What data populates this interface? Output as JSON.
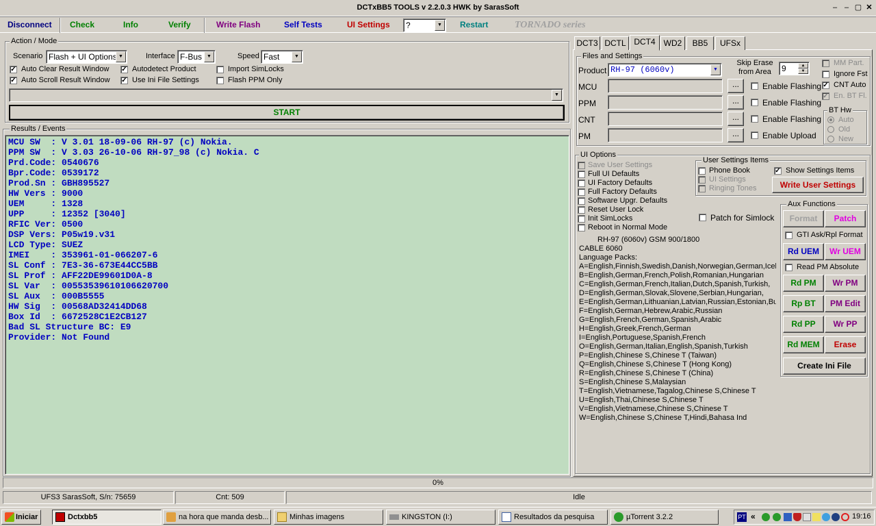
{
  "window": {
    "title": "DCTxBB5 TOOLS v 2.2.0.3 HWK by SarasSoft"
  },
  "toolbar": {
    "disconnect": "Disconnect",
    "check": "Check",
    "info": "Info",
    "verify": "Verify",
    "write_flash": "Write Flash",
    "self_tests": "Self Tests",
    "ui_settings": "UI Settings",
    "combo_value": "?",
    "restart": "Restart",
    "brand": "TORNADO series"
  },
  "action_mode": {
    "title": "Action / Mode",
    "scenario_label": "Scenario",
    "scenario_value": "Flash + UI Options",
    "interface_label": "Interface",
    "interface_value": "F-Bus",
    "speed_label": "Speed",
    "speed_value": "Fast",
    "checks": [
      {
        "label": "Auto Clear Result Window",
        "checked": true
      },
      {
        "label": "Autodetect Product",
        "checked": true
      },
      {
        "label": "Import SimLocks",
        "checked": false
      },
      {
        "label": "Auto Scroll Result Window",
        "checked": true
      },
      {
        "label": "Use Ini File Settings",
        "checked": true
      },
      {
        "label": "Flash PPM Only",
        "checked": false
      }
    ],
    "start": "START"
  },
  "results": {
    "title": "Results / Events",
    "lines": [
      "MCU SW  : V 3.01 18-09-06 RH-97 (c) Nokia.",
      "PPM SW  : V 3.03 26-10-06 RH-97_98 (c) Nokia. C",
      "Prd.Code: 0540676",
      "Bpr.Code: 0539172",
      "Prod.Sn : GBH895527",
      "HW Vers : 9000",
      "UEM     : 1328",
      "UPP     : 12352 [3040]",
      "RFIC Ver: 0500",
      "DSP Vers: P05w19.v31",
      "LCD Type: SUEZ",
      "IMEI    : 353961-01-066207-6",
      "SL Conf : 7E3-36-673E44CC5BB",
      "SL Prof : AFF22DE99601D0A-8",
      "SL Var  : 0055353961010662070­0",
      "SL Aux  : 000B5555",
      "HW Sig  : 00568AD32414DD68",
      "Box Id  : 6672528C1E2CB127",
      "Bad SL Structure BC: E9",
      "Provider: Not Found"
    ]
  },
  "tabs": [
    "DCT3",
    "DCTL",
    "DCT4",
    "WD2",
    "BB5",
    "UFSx"
  ],
  "files": {
    "title": "Files and Settings",
    "product_label": "Product",
    "product_value": "RH-97  (6060v)",
    "skip_label": "Skip Erase from Area",
    "skip_value": "9",
    "rows": [
      {
        "label": "MCU",
        "check": "Enable Flashing"
      },
      {
        "label": "PPM",
        "check": "Enable Flashing"
      },
      {
        "label": "CNT",
        "check": "Enable Flashing"
      },
      {
        "label": "PM",
        "check": "Enable Upload"
      }
    ],
    "browse": "...",
    "right_checks": [
      {
        "label": "MM Part.",
        "checked": false,
        "disabled": true
      },
      {
        "label": "Ignore Fst",
        "checked": false,
        "disabled": false
      },
      {
        "label": "CNT Auto",
        "checked": true,
        "disabled": false
      },
      {
        "label": "En. BT Fl.",
        "checked": true,
        "disabled": true
      }
    ],
    "bt_hw": {
      "title": "BT Hw",
      "options": [
        "Auto",
        "Old",
        "New"
      ]
    }
  },
  "ui_options": {
    "title": "UI Options",
    "checks": [
      {
        "label": "Save User Settings",
        "disabled": true
      },
      {
        "label": "Full UI Defaults",
        "disabled": false
      },
      {
        "label": "UI Factory Defaults",
        "disabled": false
      },
      {
        "label": "Full Factory Defaults",
        "disabled": false
      },
      {
        "label": "Software Upgr. Defaults",
        "disabled": false
      },
      {
        "label": "Reset User Lock",
        "disabled": false
      },
      {
        "label": "Init SimLocks",
        "disabled": false
      },
      {
        "label": "Reboot in Normal Mode",
        "disabled": false
      }
    ],
    "patch_simlock": "Patch for Simlock",
    "user_settings": {
      "title": "User Settings Items",
      "items": [
        {
          "label": "Phone Book",
          "disabled": false
        },
        {
          "label": "UI Settings",
          "disabled": true
        },
        {
          "label": "Ringing Tones",
          "disabled": true
        }
      ],
      "show": "Show Settings Items",
      "write": "Write User Settings"
    }
  },
  "info_text": {
    "header": "RH-97 (6060v) GSM 900/1800",
    "cable": "CABLE 6060",
    "packs_title": "Language Packs:",
    "packs": [
      "A=English,Finnish,Swedish,Danish,Norwegian,German,Icelar",
      "B=English,German,French,Polish,Romanian,Hungarian",
      "C=English,German,French,Italian,Dutch,Spanish,Turkish,",
      "D=English,German,Slovak,Slovene,Serbian,Hungarian,",
      "E=English,German,Lithuanian,Latvian,Russian,Estonian,Bulg",
      "F=English,German,Hebrew,Arabic,Russian",
      "G=English,French,German,Spanish,Arabic",
      "H=English,Greek,French,German",
      "I=English,Portuguese,Spanish,French",
      "O=English,German,Italian,English,Spanish,Turkish",
      "P=English,Chinese S,Chinese T (Taiwan)",
      "Q=English,Chinese S,Chinese T (Hong Kong)",
      "R=English,Chinese S,Chinese T (China)",
      "S=English,Chinese S,Malaysian",
      "T=English,Vietnamese,Tagalog,Chinese S,Chinese T",
      "U=English,Thai,Chinese S,Chinese T",
      "V=English,Vietnamese,Chinese S,Chinese T",
      "W=English,Chinese S,Chinese T,Hindi,Bahasa Ind"
    ]
  },
  "aux": {
    "title": "Aux Functions",
    "format": "Format",
    "patch": "Patch",
    "gti": "GTI Ask/Rpl Format",
    "rd_uem": "Rd UEM",
    "wr_uem": "Wr UEM",
    "read_pm_abs": "Read PM Absolute",
    "rd_pm": "Rd PM",
    "wr_pm": "Wr PM",
    "rp_bt": "Rp BT",
    "pm_edit": "PM Edit",
    "rd_pp": "Rd PP",
    "wr_pp": "Wr PP",
    "rd_mem": "Rd MEM",
    "erase": "Erase",
    "create_ini": "Create Ini File"
  },
  "progress": {
    "percent": "0%",
    "value": 0
  },
  "statusbar": {
    "serial": "UFS3 SarasSoft, S/n: 75659",
    "count": "Cnt: 509",
    "state": "Idle"
  },
  "taskbar": {
    "start": "Iniciar",
    "tasks": [
      "Dctxbb5",
      "na hora que manda desb...",
      "Minhas imagens",
      "KINGSTON (I:)",
      "Resultados da pesquisa",
      "µTorrent 3.2.2"
    ],
    "lang": "PT",
    "clock": "19:16"
  },
  "colors": {
    "green": "#008000",
    "purple": "#800080",
    "blue": "#0000c0",
    "red": "#c00000",
    "magenta": "#e000e0",
    "teal": "#008080",
    "results_bg": "#c0dcc0"
  }
}
